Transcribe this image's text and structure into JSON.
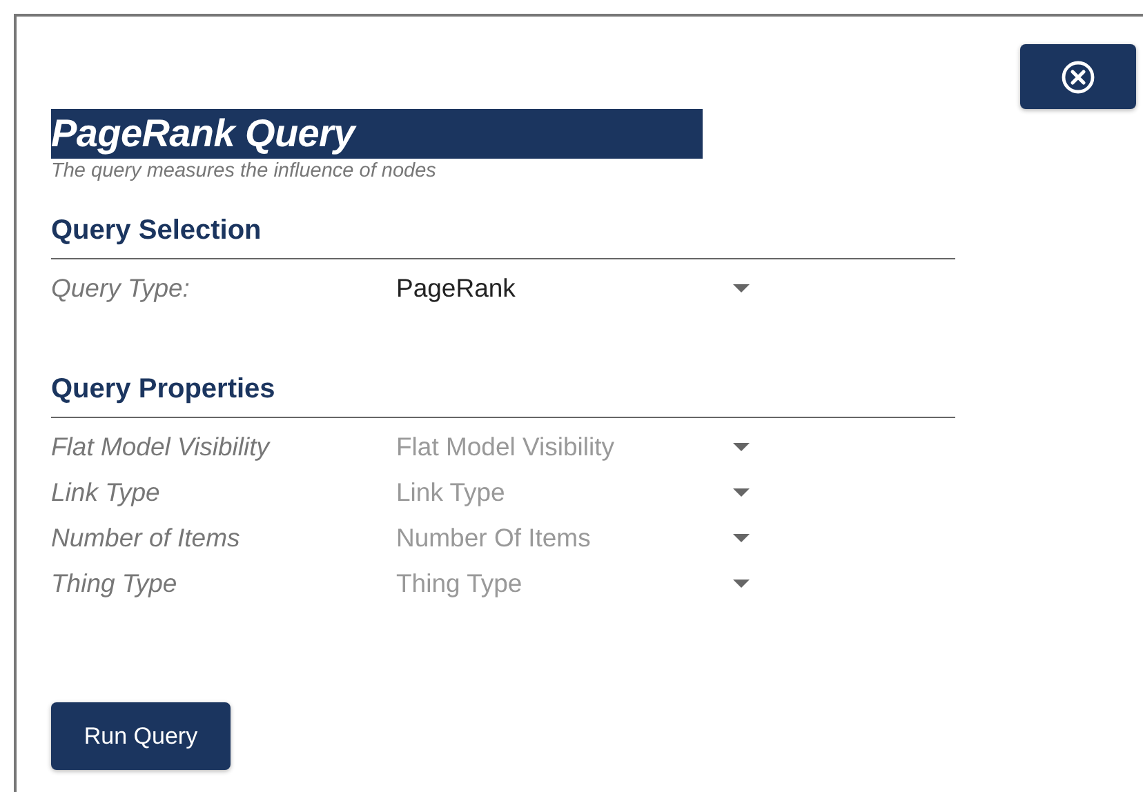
{
  "title": "PageRank Query",
  "subtitle": "The query measures the influence of nodes",
  "sections": [
    {
      "heading": "Query Selection",
      "fields": [
        {
          "label": "Query Type:",
          "value": "PageRank"
        }
      ]
    },
    {
      "heading": "Query Properties",
      "fields": [
        {
          "label": "Flat Model Visibility",
          "placeholder": "Flat Model Visibility"
        },
        {
          "label": "Link Type",
          "placeholder": "Link Type"
        },
        {
          "label": "Number of Items",
          "placeholder": "Number Of Items"
        },
        {
          "label": "Thing Type",
          "placeholder": "Thing Type"
        }
      ]
    }
  ],
  "run_button": "Run Query"
}
